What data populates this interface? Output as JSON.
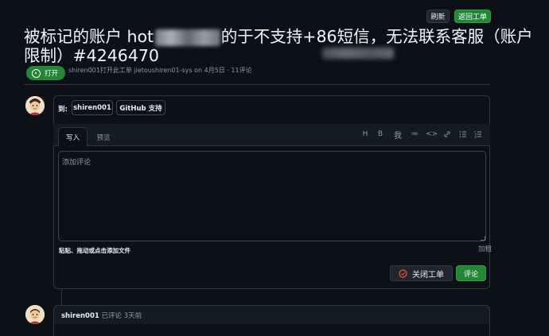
{
  "header": {
    "refresh_label": "刷新",
    "back_label": "返回工单"
  },
  "issue": {
    "title": "被标记的账户 hot             的于不支持+86短信，无法联系客服（账户限制）#4246470",
    "state_label": "打开",
    "meta": "shiren001打开此工单 jietoushiren01-sys on 4月5日 · 11评论"
  },
  "assign": {
    "label": "到:",
    "chips": [
      "shiren001",
      "GitHub 支持"
    ]
  },
  "editor": {
    "tabs": [
      "写入",
      "预览"
    ],
    "toolbar": [
      "H",
      "B",
      "我",
      "≔",
      "<>",
      "🔗",
      "☰",
      "⋮≡"
    ],
    "placeholder": "添加评论",
    "attach_hint": "粘贴、拖动或点击添加文件",
    "markdown_label": "加粗",
    "close_label": "关闭工单",
    "comment_label": "评论"
  },
  "comment": {
    "author": "shiren001",
    "action": "已评论 3天前"
  },
  "colors": {
    "green": "#238636",
    "bg": "#0d1117",
    "close_icon": "#f85149"
  }
}
